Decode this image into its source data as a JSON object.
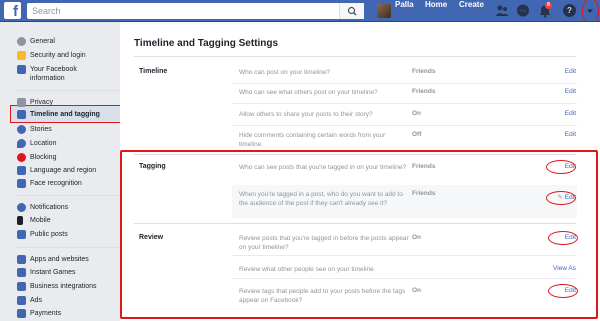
{
  "topbar": {
    "logo": "f",
    "search_placeholder": "Search",
    "user_name": "Palla",
    "home_label": "Home",
    "create_label": "Create",
    "notification_count": "8",
    "help_label": "?",
    "brand_color": "#4267b2"
  },
  "sidebar": {
    "items": [
      {
        "label": "General",
        "icon": "gear-icon",
        "color": "#8d949e"
      },
      {
        "label": "Security and login",
        "icon": "shield-icon",
        "color": "#f7b928"
      },
      {
        "label": "Your Facebook information",
        "icon": "facebook-icon",
        "color": "#4267b2"
      },
      {
        "label": "Privacy",
        "icon": "lock-icon",
        "color": "#8d949e"
      },
      {
        "label": "Timeline and tagging",
        "icon": "timeline-icon",
        "color": "#4267b2"
      },
      {
        "label": "Stories",
        "icon": "stories-icon",
        "color": "#4267b2"
      },
      {
        "label": "Location",
        "icon": "location-icon",
        "color": "#4267b2"
      },
      {
        "label": "Blocking",
        "icon": "blocking-icon",
        "color": "#e0171a"
      },
      {
        "label": "Language and region",
        "icon": "language-icon",
        "color": "#4267b2"
      },
      {
        "label": "Face recognition",
        "icon": "face-recognition-icon",
        "color": "#4267b2"
      },
      {
        "label": "Notifications",
        "icon": "globe-icon",
        "color": "#4267b2"
      },
      {
        "label": "Mobile",
        "icon": "mobile-icon",
        "color": "#1d2129"
      },
      {
        "label": "Public posts",
        "icon": "rss-icon",
        "color": "#4267b2"
      },
      {
        "label": "Apps and websites",
        "icon": "apps-icon",
        "color": "#4267b2"
      },
      {
        "label": "Instant Games",
        "icon": "games-icon",
        "color": "#4267b2"
      },
      {
        "label": "Business integrations",
        "icon": "business-icon",
        "color": "#4267b2"
      },
      {
        "label": "Ads",
        "icon": "ads-icon",
        "color": "#4267b2"
      },
      {
        "label": "Payments",
        "icon": "payments-icon",
        "color": "#4267b2"
      }
    ],
    "active_index": 4
  },
  "main": {
    "title": "Timeline and Tagging Settings",
    "sections": [
      {
        "label": "Timeline",
        "rows": [
          {
            "question": "Who can post on your timeline?",
            "value": "Friends",
            "action": "Edit"
          },
          {
            "question": "Who can see what others post on your timeline?",
            "value": "Friends",
            "action": "Edit"
          },
          {
            "question": "Allow others to share your posts to their story?",
            "value": "On",
            "action": "Edit"
          },
          {
            "question": "Hide comments containing certain words from your timeline",
            "value": "Off",
            "action": "Edit"
          }
        ]
      },
      {
        "label": "Tagging",
        "rows": [
          {
            "question": "Who can see posts that you're tagged in on your timeline?",
            "value": "Friends",
            "action": "Edit"
          },
          {
            "question": "When you're tagged in a post, who do you want to add to the audience of the post if they can't already see it?",
            "value": "Friends",
            "action": "Edit"
          }
        ]
      },
      {
        "label": "Review",
        "rows": [
          {
            "question": "Review posts that you're tagged in before the posts appear on your timeline?",
            "value": "On",
            "action": "Edit"
          },
          {
            "question": "Review what other people see on your timeline",
            "value": "",
            "action": "View As"
          },
          {
            "question": "Review tags that people add to your posts before the tags appear on Facebook?",
            "value": "On",
            "action": "Edit"
          }
        ]
      }
    ]
  },
  "annotation_color": "#e0171a"
}
